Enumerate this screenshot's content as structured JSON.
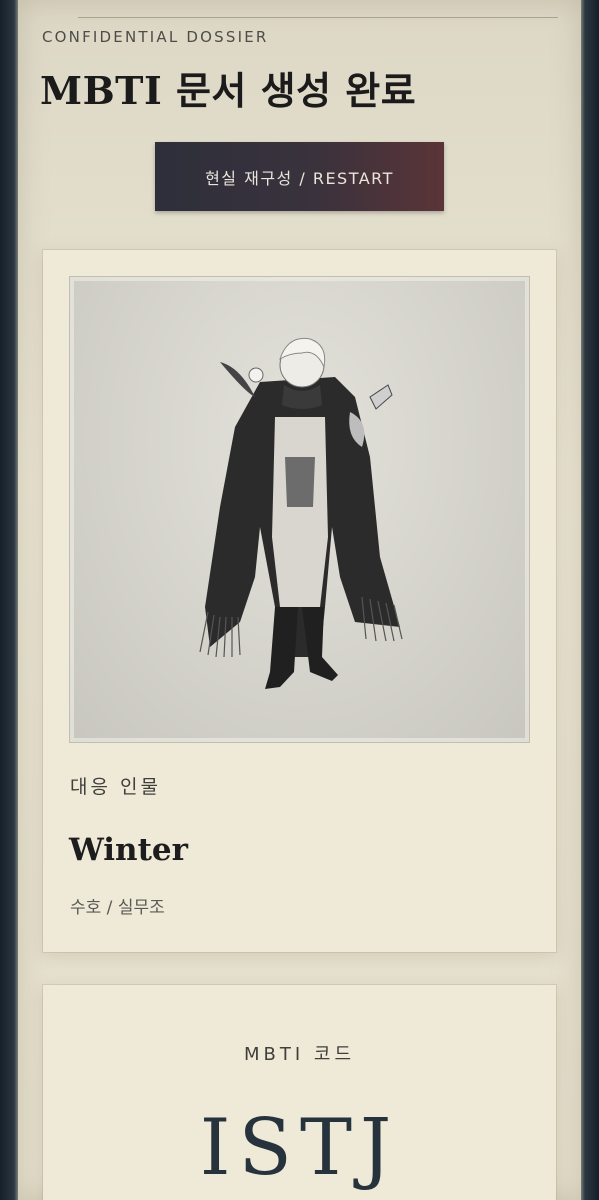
{
  "header": {
    "kicker": "CONFIDENTIAL DOSSIER",
    "title": "MBTI 문서 생성 완료",
    "restart_label": "현실 재구성 / RESTART"
  },
  "character": {
    "section_label": "대응 인물",
    "name": "Winter",
    "role": "수호 / 실무조",
    "portrait_icon": "character-portrait"
  },
  "mbti": {
    "label": "MBTI 코드",
    "code": "ISTJ"
  },
  "colors": {
    "button_start": "#2d2f3b",
    "button_end": "#5a3438",
    "paper": "#e9e4d2",
    "code_text": "#26333c"
  }
}
